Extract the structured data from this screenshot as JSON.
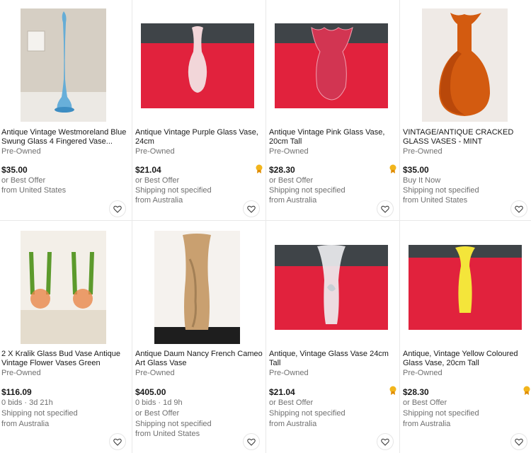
{
  "listings": [
    {
      "title": "Antique Vintage Westmoreland Blue Swung Glass 4 Fingered Vase...",
      "condition": "Pre-Owned",
      "price": "$35.00",
      "lines": [
        "or Best Offer",
        "from United States"
      ],
      "top_rated": false
    },
    {
      "title": "Antique Vintage Purple Glass Vase, 24cm",
      "condition": "Pre-Owned",
      "price": "$21.04",
      "lines": [
        "or Best Offer",
        "Shipping not specified",
        "from Australia"
      ],
      "top_rated": true
    },
    {
      "title": "Antique Vintage Pink Glass Vase, 20cm Tall",
      "condition": "Pre-Owned",
      "price": "$28.30",
      "lines": [
        "or Best Offer",
        "Shipping not specified",
        "from Australia"
      ],
      "top_rated": true
    },
    {
      "title": "VINTAGE/ANTIQUE CRACKED GLASS VASES - MINT",
      "condition": "Pre-Owned",
      "price": "$35.00",
      "lines": [
        "Buy It Now",
        "Shipping not specified",
        "from United States"
      ],
      "top_rated": false
    },
    {
      "title": "2 X Kralik Glass Bud Vase Antique Vintage Flower Vases Green",
      "condition": "Pre-Owned",
      "price": "$116.09",
      "lines": [
        "0 bids · 3d 21h",
        "Shipping not specified",
        "from Australia"
      ],
      "top_rated": false
    },
    {
      "title": "Antique Daum Nancy French Cameo Art Glass Vase",
      "condition": "Pre-Owned",
      "price": "$405.00",
      "lines": [
        "0 bids · 1d 9h",
        "or Best Offer",
        "Shipping not specified",
        "from United States"
      ],
      "top_rated": false
    },
    {
      "title": "Antique, Vintage Glass Vase 24cm Tall",
      "condition": "Pre-Owned",
      "price": "$21.04",
      "lines": [
        "or Best Offer",
        "Shipping not specified",
        "from Australia"
      ],
      "top_rated": true
    },
    {
      "title": "Antique, Vintage Yellow Coloured Glass Vase, 20cm Tall",
      "condition": "Pre-Owned",
      "price": "$28.30",
      "lines": [
        "or Best Offer",
        "Shipping not specified",
        "from Australia"
      ],
      "top_rated": true
    }
  ],
  "icons": {
    "watch": "heart-icon",
    "top_rated": "top-rated-seller-icon"
  },
  "colors": {
    "price": "#191919",
    "secondary": "#707070",
    "divider": "#e9e9e9"
  }
}
